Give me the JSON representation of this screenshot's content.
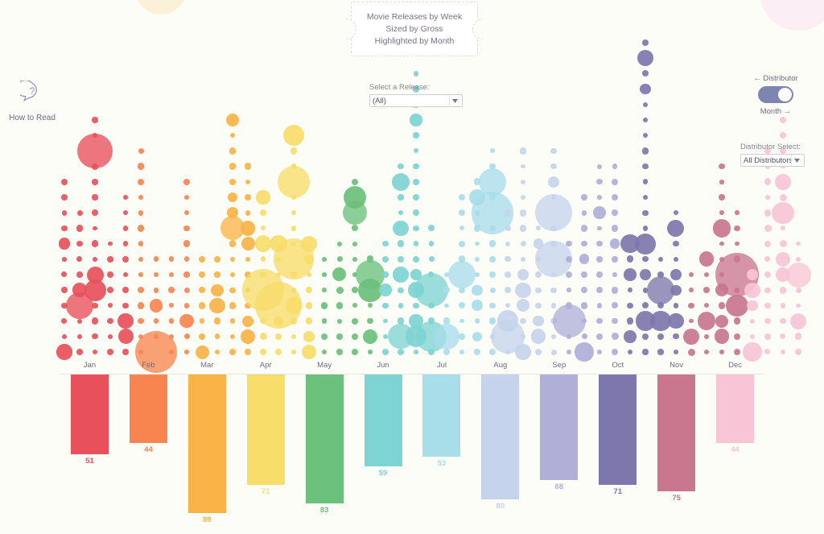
{
  "page": {
    "background": "#fdfdf8",
    "title_card": {
      "lines": [
        "Movie Releases by Week",
        "Sized by Gross",
        "Highlighted by Month"
      ]
    }
  },
  "help": {
    "icon": "question-speech-bubble-icon",
    "label": "How to Read"
  },
  "controls": {
    "release": {
      "label": "Select a Release:",
      "value": "(All)",
      "options": [
        "(All)"
      ]
    },
    "mode_toggle": {
      "left_label": "← Distributor",
      "right_label": "Month →",
      "state": "Month",
      "track_color": "#7e85b0",
      "knob_color": "#ffffff"
    },
    "distributor": {
      "label": "Distributor Select:",
      "value": "All Distributors",
      "options": [
        "All Distributors"
      ]
    }
  },
  "chart_data": {
    "type": "bar",
    "title": "Movie Releases by Week",
    "subtitle": "Sized by Gross / Highlighted by Month",
    "xlabel": "",
    "ylabel": "",
    "grid": false,
    "legend": "none",
    "ylim": [
      0,
      89
    ],
    "categories": [
      "Jan",
      "Feb",
      "Mar",
      "Apr",
      "May",
      "Jun",
      "Jul",
      "Aug",
      "Sep",
      "Oct",
      "Nov",
      "Dec"
    ],
    "values": [
      51,
      44,
      89,
      71,
      83,
      59,
      53,
      80,
      68,
      71,
      75,
      44
    ],
    "colors": [
      "#e8505b",
      "#f8854f",
      "#fab347",
      "#f7dd6a",
      "#6bc07b",
      "#7ed4d2",
      "#a8ddea",
      "#c5d4ec",
      "#afafd8",
      "#7e77ac",
      "#c9768f",
      "#f7c5d6"
    ],
    "note": "Bars hang downward from the month axis; value labels appear below each bar in the bar's own color."
  },
  "bubble_plot": {
    "description": "Weekly movie releases plotted as circles, one column per week, sized by gross, colored by month.",
    "columns_per_month": 4.33,
    "month_colors": [
      "#e8505b",
      "#f8854f",
      "#fab347",
      "#f7dd6a",
      "#6bc07b",
      "#7ed4d2",
      "#a8ddea",
      "#c5d4ec",
      "#afafd8",
      "#7e77ac",
      "#c9768f",
      "#f7c5d6"
    ]
  }
}
